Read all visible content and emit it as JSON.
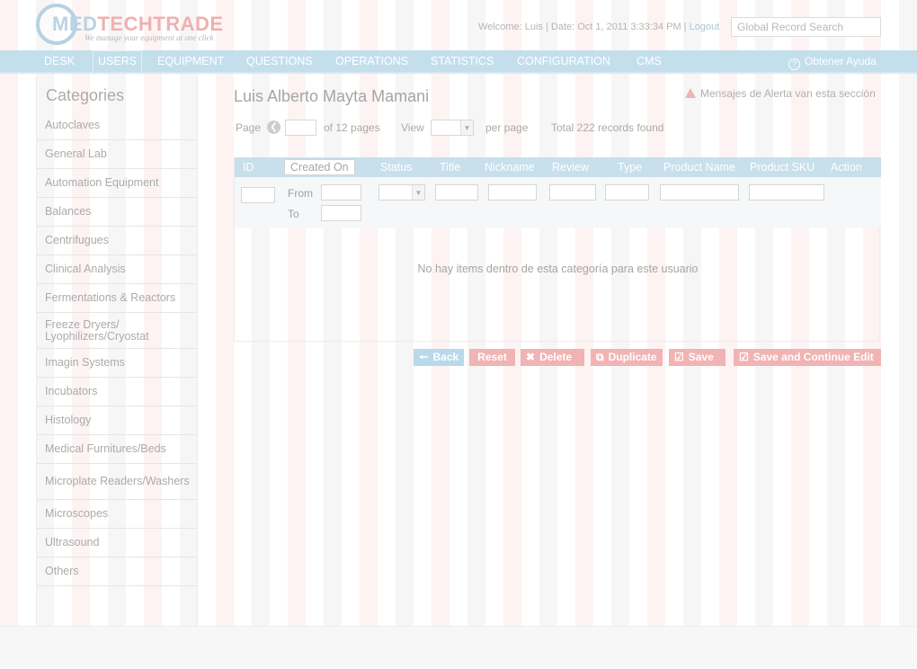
{
  "brand": {
    "name_part1": "MED",
    "name_part2": "TECHTRADE",
    "tagline": "We manage your equipment at one click"
  },
  "header": {
    "welcome": "Welcome: Luis | Date: Oct 1, 2011 3:33:34 PM | ",
    "logout_label": "Logout",
    "search_placeholder": "Global Record Search"
  },
  "nav": {
    "items": [
      {
        "label": "DESK"
      },
      {
        "label": "USERS",
        "active": true
      },
      {
        "label": "EQUIPMENT"
      },
      {
        "label": "QUESTIONS"
      },
      {
        "label": "OPERATIONS"
      },
      {
        "label": "STATISTICS"
      },
      {
        "label": "CONFIGURATION"
      },
      {
        "label": "CMS"
      }
    ],
    "help_label": "Obtener Ayuda"
  },
  "sidebar": {
    "title": "Categories",
    "items": [
      {
        "label": "Autoclaves"
      },
      {
        "label": "General Lab"
      },
      {
        "label": "Automation Equipment"
      },
      {
        "label": "Balances"
      },
      {
        "label": "Centrifugues"
      },
      {
        "label": "Clinical Analysis"
      },
      {
        "label": "Fermentations & Reactors"
      },
      {
        "label": "Freeze Dryers/ Lyophilizers/Cryostat"
      },
      {
        "label": "Imagin Systems"
      },
      {
        "label": "Incubators"
      },
      {
        "label": "Histology"
      },
      {
        "label": "Medical Furnitures/Beds"
      },
      {
        "label": "Microplate Readers/Washers"
      },
      {
        "label": "Microscopes"
      },
      {
        "label": "Ultrasound"
      },
      {
        "label": "Others"
      }
    ]
  },
  "main": {
    "title": "Luis Alberto Mayta Mamani",
    "alert": "Mensajes de Alerta van esta sección",
    "pager": {
      "page_label": "Page",
      "of_label": "of 12 pages",
      "view_label": "View",
      "per_page_label": "per page",
      "total_label": "Total 222 records found"
    },
    "table": {
      "columns": [
        {
          "label": "ID"
        },
        {
          "label": "Created On"
        },
        {
          "label": "Status"
        },
        {
          "label": "Title"
        },
        {
          "label": "Nickname"
        },
        {
          "label": "Review"
        },
        {
          "label": "Type"
        },
        {
          "label": "Product Name"
        },
        {
          "label": "Product SKU"
        },
        {
          "label": "Action"
        }
      ],
      "from_label": "From",
      "to_label": "To",
      "empty_message": "No hay items dentro de esta categoría para este usuario"
    },
    "buttons": {
      "back": "Back",
      "reset": "Reset",
      "delete": "Delete",
      "duplicate": "Duplicate",
      "save": "Save",
      "save_continue": "Save and Continue Edit"
    }
  },
  "colors": {
    "nav_bg": "#c4dfec",
    "table_head_bg": "#c8e0ec",
    "accent_blue": "#b9d9ea",
    "accent_red": "#f1b3b3"
  }
}
